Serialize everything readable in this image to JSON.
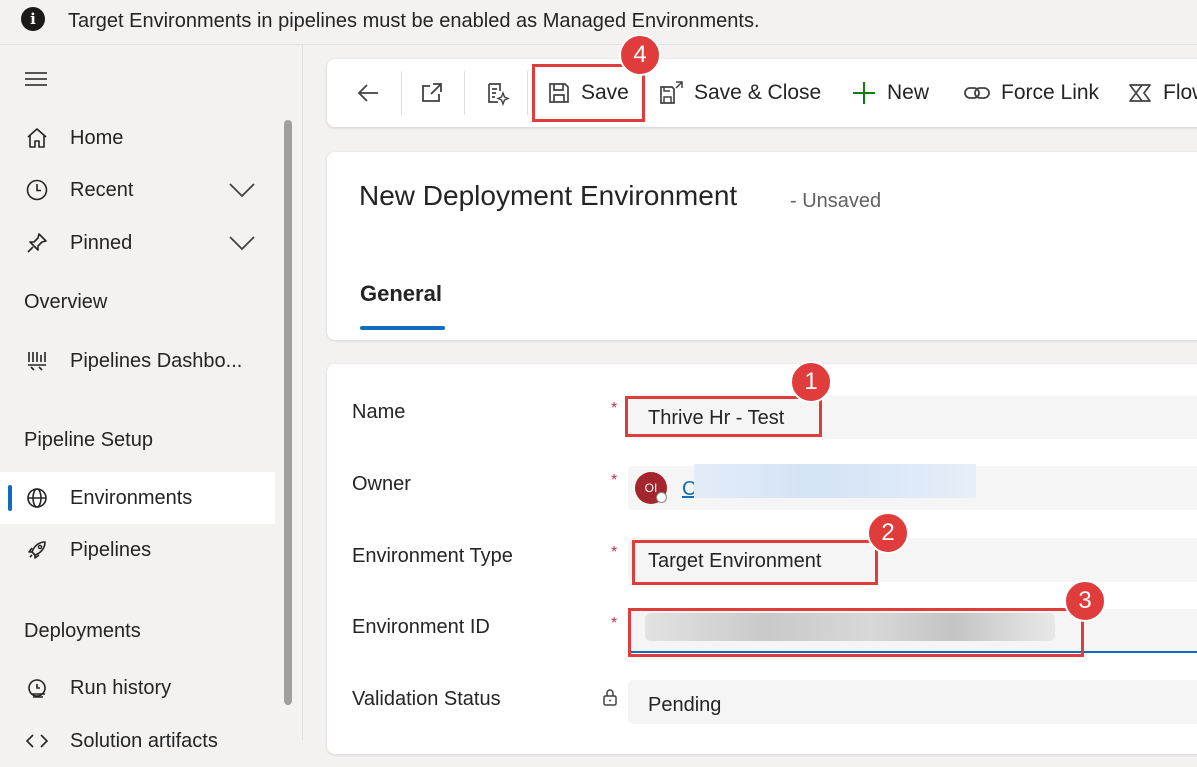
{
  "banner": {
    "message": "Target Environments in pipelines must be enabled as Managed Environments."
  },
  "sidebar": {
    "items": [
      {
        "label": "Home",
        "icon": "home-icon"
      },
      {
        "label": "Recent",
        "icon": "clock-icon"
      },
      {
        "label": "Pinned",
        "icon": "pin-icon"
      }
    ],
    "overview_header": "Overview",
    "overview_items": [
      {
        "label": "Pipelines Dashbo...",
        "icon": "dashboard-icon"
      }
    ],
    "pipeline_setup_header": "Pipeline Setup",
    "pipeline_setup_items": [
      {
        "label": "Environments",
        "icon": "globe-icon",
        "selected": true
      },
      {
        "label": "Pipelines",
        "icon": "rocket-icon"
      }
    ],
    "deployments_header": "Deployments",
    "deployments_items": [
      {
        "label": "Run history",
        "icon": "history-icon"
      },
      {
        "label": "Solution artifacts",
        "icon": "code-icon"
      }
    ]
  },
  "command_bar": {
    "save": "Save",
    "save_close": "Save & Close",
    "new": "New",
    "force_link": "Force Link",
    "flow": "Flow"
  },
  "record": {
    "title": "New Deployment Environment",
    "status": "- Unsaved",
    "tab": "General"
  },
  "form": {
    "name_label": "Name",
    "name_value": "Thrive Hr - Test",
    "owner_label": "Owner",
    "owner_initials": "OI",
    "owner_value": "C",
    "env_type_label": "Environment Type",
    "env_type_value": "Target Environment",
    "env_id_label": "Environment ID",
    "validation_label": "Validation Status",
    "validation_value": "Pending",
    "required_mark": "*"
  },
  "annotations": {
    "badge1": "1",
    "badge2": "2",
    "badge3": "3",
    "badge4": "4"
  },
  "colors": {
    "accent": "#0f6cbd",
    "annotation": "#e03c3c",
    "required": "#c4314b"
  }
}
